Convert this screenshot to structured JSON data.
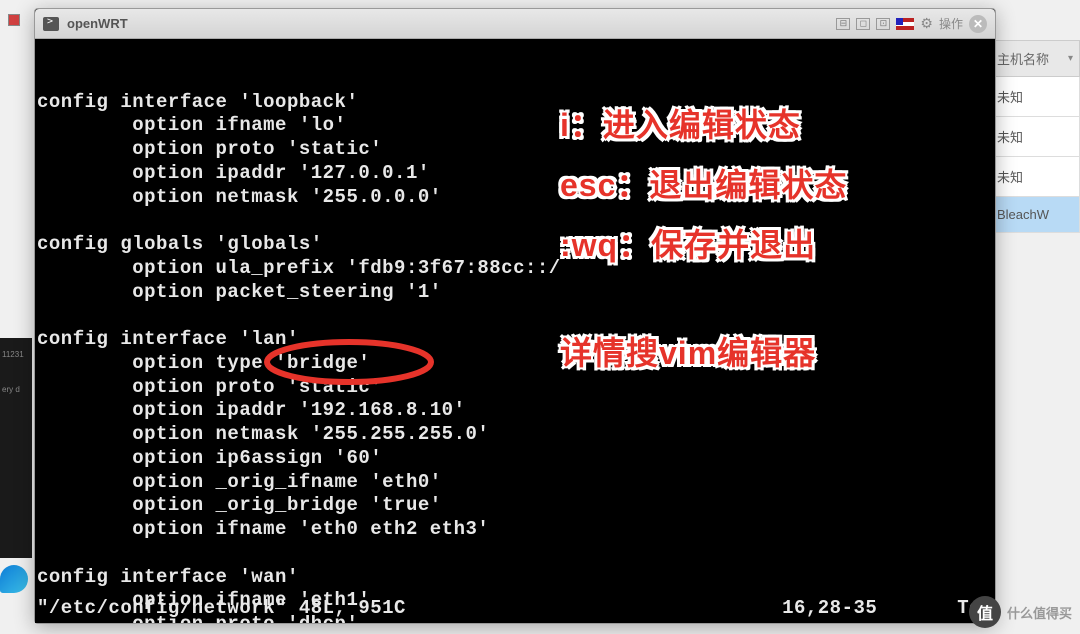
{
  "window": {
    "title": "openWRT",
    "ops_label": "操作"
  },
  "bg": {
    "header": "主机名称",
    "rows": [
      "未知",
      "未知",
      "未知",
      "BleachW"
    ]
  },
  "terminal": {
    "lines": [
      "config interface 'loopback'",
      "        option ifname 'lo'",
      "        option proto 'static'",
      "        option ipaddr '127.0.0.1'",
      "        option netmask '255.0.0.0'",
      "",
      "config globals 'globals'",
      "        option ula_prefix 'fdb9:3f67:88cc::/",
      "        option packet_steering '1'",
      "",
      "config interface 'lan'",
      "        option type 'bridge'",
      "        option proto 'static'",
      "        option ipaddr '192.168.8.10'",
      "        option netmask '255.255.255.0'",
      "        option ip6assign '60'",
      "        option _orig_ifname 'eth0'",
      "        option _orig_bridge 'true'",
      "        option ifname 'eth0 eth2 eth3'",
      "",
      "config interface 'wan'",
      "        option ifname 'eth1'",
      "        option proto 'dhcp'"
    ],
    "status_file": "\"/etc/config/network\" 48L, 951C",
    "status_pos": "16,28-35",
    "status_right": "Top"
  },
  "annotations": {
    "line1": "i：进入编辑状态",
    "line2": "esc：退出编辑状态",
    "line3": ":wq：保存并退出",
    "line4": "详情搜vim编辑器"
  },
  "watermark": {
    "icon": "值",
    "text": "什么值得买"
  },
  "left_text": {
    "t1": "11231",
    "t2": "ery d"
  }
}
